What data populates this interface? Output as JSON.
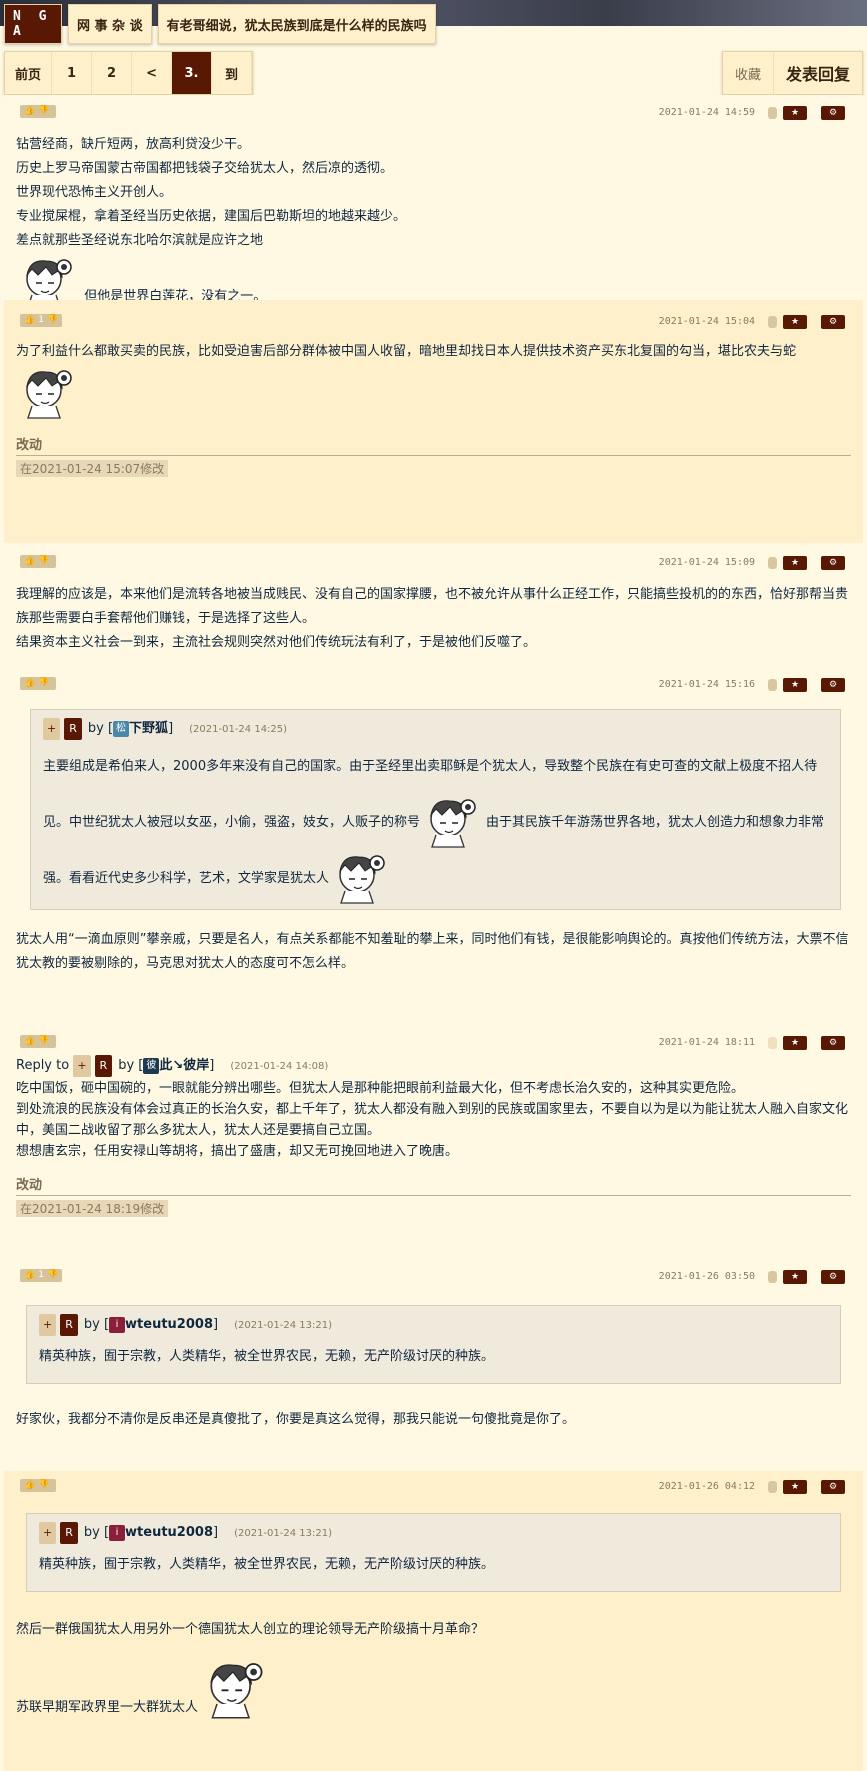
{
  "topnav": {
    "logo": "N G A",
    "forum": "网 事 杂 谈",
    "thread_title": "有老哥细说，犹太民族到底是什么样的民族吗"
  },
  "pager": {
    "first": "前页",
    "p1": "1",
    "p2": "2",
    "prev": "<",
    "current": "3.",
    "goto": "到"
  },
  "actions": {
    "favorite": "收藏",
    "reply": "发表回复"
  },
  "posts": [
    {
      "vote": "",
      "time": "2021-01-24 14:59",
      "lines": [
        "钻营经商，缺斤短两，放高利贷没少干。",
        "历史上罗马帝国蒙古帝国都把钱袋子交给犹太人，然后凉的透彻。",
        "世界现代恐怖主义开创人。",
        "专业搅屎棍，拿着圣经当历史依据，建国后巴勒斯坦的地越来越少。",
        "差点就那些圣经说东北哈尔滨就是应许之地"
      ],
      "tail": "但他是世界白莲花，没有之一。"
    },
    {
      "vote": "1",
      "time": "2021-01-24 15:04",
      "text": "为了利益什么都敢买卖的民族，比如受迫害后部分群体被中国人收留，暗地里却找日本人提供技术资产买东北复国的勾当，堪比农夫与蛇",
      "edit_label": "改动",
      "edit_stamp": "在2021-01-24 15:07修改"
    },
    {
      "vote": "",
      "time": "2021-01-24 15:09",
      "lines": [
        "我理解的应该是，本来他们是流转各地被当成贱民、没有自己的国家撑腰，也不被允许从事什么正经工作，只能搞些投机的的东西，恰好那帮当贵族那些需要白手套帮他们赚钱，于是选择了这些人。",
        "结果资本主义社会一到来，主流社会规则突然对他们传统玩法有利了，于是被他们反噬了。"
      ]
    },
    {
      "vote": "",
      "time": "2021-01-24 15:16",
      "quote": {
        "tag": "+",
        "r": "R",
        "by": "by",
        "avatar": "松",
        "user": "下野狐",
        "time": "(2021-01-24 14:25)",
        "l1": "主要组成是希伯来人，2000多年来没有自己的国家。由于圣经里出卖耶稣是个犹太人，导致整个民族在有史可查的文献上极度不招人待",
        "l2a": "见。中世纪犹太人被冠以女巫，小偷，强盗，妓女，人贩子的称号",
        "l2b": "由于其民族千年游荡世界各地，犹太人创造力和想象力非常",
        "l3": "强。看看近代史多少科学，艺术，文学家是犹太人"
      },
      "lines": [
        "犹太人用“一滴血原则”攀亲戚，只要是名人，有点关系都能不知羞耻的攀上来，同时他们有钱，是很能影响舆论的。真按他们传统方法，大票不信犹太教的要被剔除的，马克思对犹太人的态度可不怎么样。"
      ]
    },
    {
      "vote": "",
      "time": "2021-01-24 18:11",
      "reply": {
        "prefix": "Reply to",
        "tag": "+",
        "r": "R",
        "by": "by",
        "avatar": "彼",
        "user": "此↘彼岸",
        "time": "(2021-01-24 14:08)"
      },
      "lines": [
        "吃中国饭，砸中国碗的，一眼就能分辨出哪些。但犹太人是那种能把眼前利益最大化，但不考虑长治久安的，这种其实更危险。",
        "到处流浪的民族没有体会过真正的长治久安，都上千年了，犹太人都没有融入到别的民族或国家里去，不要自以为是以为能让犹太人融入自家文化中，美国二战收留了那么多犹太人，犹太人还是要搞自己立国。",
        "想想唐玄宗，任用安禄山等胡将，搞出了盛唐，却又无可挽回地进入了晚唐。"
      ],
      "edit_label": "改动",
      "edit_stamp": "在2021-01-24 18:19修改"
    },
    {
      "vote": "1",
      "time": "2021-01-26 03:50",
      "quote": {
        "tag": "+",
        "r": "R",
        "by": "by",
        "avatar": "i",
        "user": "wteutu2008",
        "time": "(2021-01-24 13:21)",
        "l1": "精英种族，囿于宗教，人类精华，被全世界农民，无赖，无产阶级讨厌的种族。"
      },
      "lines": [
        "好家伙，我都分不清你是反串还是真傻批了，你要是真这么觉得，那我只能说一句傻批竟是你了。"
      ]
    },
    {
      "vote": "",
      "time": "2021-01-26 04:12",
      "quote": {
        "tag": "+",
        "r": "R",
        "by": "by",
        "avatar": "i",
        "user": "wteutu2008",
        "time": "(2021-01-24 13:21)",
        "l1": "精英种族，囿于宗教，人类精华，被全世界农民，无赖，无产阶级讨厌的种族。"
      },
      "lines": [
        "然后一群俄国犹太人用另外一个德国犹太人创立的理论领导无产阶级搞十月革命？"
      ],
      "tail": "苏联早期军政界里一大群犹太人"
    }
  ],
  "colors": {
    "brand": "#591804",
    "bg_a": "#fff9e3",
    "bg_b": "#fff0cc",
    "quote_bg": "#f0eadc"
  }
}
